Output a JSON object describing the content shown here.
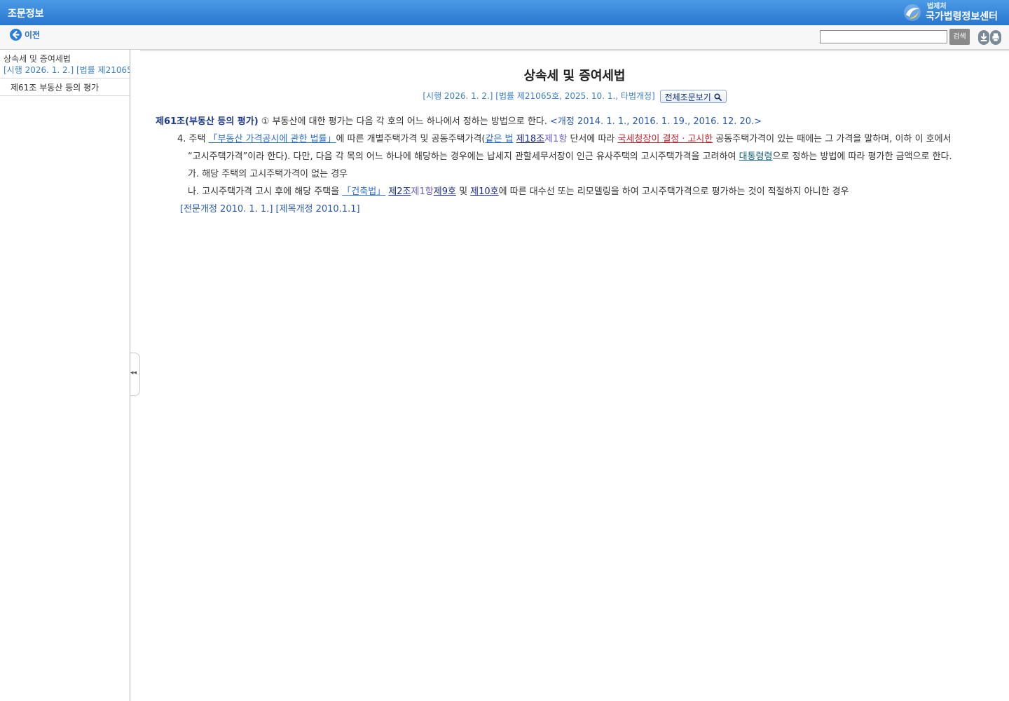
{
  "app": {
    "title": "조문정보",
    "logo_small": "법제처",
    "logo_big": "국가법령정보센터"
  },
  "toolbar": {
    "back_label": "이전",
    "search_placeholder": "",
    "search_button": "검색"
  },
  "sidebar": {
    "law_name": "상속세 및 증여세법",
    "law_meta": "[시행 2026. 1. 2.] [법률 제21065호",
    "items": [
      {
        "label": "제61조 부동산 등의 평가"
      }
    ]
  },
  "document": {
    "title": "상속세 및 증여세법",
    "meta": "[시행 2026. 1. 2.] [법률 제21065호, 2025. 10. 1., 타법개정]",
    "fullview_button": "전체조문보기",
    "article_title": "제61조(부동산 등의 평가)",
    "paragraph1": " ① 부동산에 대한 평가는 다음 각 호의 어느 하나에서 정하는 방법으로 한다. ",
    "paragraph1_amend": "<개정 2014. 1. 1., 2016. 1. 19., 2016. 12. 20.>",
    "item4": {
      "prefix": "4. 주택 ",
      "link_law": "「부동산 가격공시에 관한 법률」",
      "text1": "에 따른 개별주택가격 및 공동주택가격(",
      "link_same": "같은 법",
      "link_art18": "제18조",
      "link_para1": "제1항",
      "text2": " 단서에 따라 ",
      "link_nts": "국세청장이 결정ㆍ고시한",
      "text3": " 공동주택가격이 있는 때에는 그 가격을 말하며, 이하 이 호에서",
      "line2_text": "“고시주택가격”이라 한다). 다만, 다음 각 목의 어느 하나에 해당하는 경우에는 납세지 관할세무서장이 인근 유사주택의 고시주택가격을 고려하여 ",
      "link_decree": "대통령령",
      "line2_tail": "으로 정하는 방법에 따라 평가한 금액으로 한다."
    },
    "sub_ga": "가. 해당 주택의 고시주택가격이 없는 경우",
    "sub_na": {
      "prefix": "나. 고시주택가격 고시 후에 해당 주택을 ",
      "link_building": "「건축법」",
      "link_art2": "제2조",
      "link_para1": "제1항",
      "link_no9": "제9호",
      "text_and": " 및 ",
      "link_no10": "제10호",
      "tail": "에 따른 대수선 또는 리모델링을 하여 고시주택가격으로 평가하는 것이 적절하지 아니한 경우"
    },
    "revision": "[전문개정 2010. 1. 1.] [제목개정 2010.1.1]"
  }
}
